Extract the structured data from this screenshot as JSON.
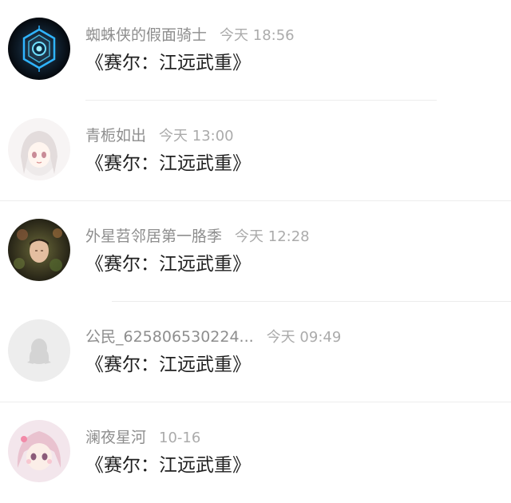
{
  "comments": [
    {
      "username": "蜘蛛侠的假面骑士",
      "time": "今天 18:56",
      "text": "《赛尔：江远武重》",
      "avatar_icon": "hex-tech-avatar-icon"
    },
    {
      "username": "青栀如出",
      "time": "今天 13:00",
      "text": "《赛尔：江远武重》",
      "avatar_icon": "anime-girl-avatar-icon"
    },
    {
      "username": "外星苕邻居第一胳季",
      "time": "今天 12:28",
      "text": "《赛尔：江远武重》",
      "avatar_icon": "person-photo-avatar-icon"
    },
    {
      "username": "公民_625806530224...",
      "time": "今天 09:49",
      "text": "《赛尔：江远武重》",
      "avatar_icon": "default-penguin-avatar-icon"
    },
    {
      "username": "澜夜星河",
      "time": "10-16",
      "text": "《赛尔：江远武重》",
      "avatar_icon": "pink-anime-avatar-icon"
    }
  ]
}
